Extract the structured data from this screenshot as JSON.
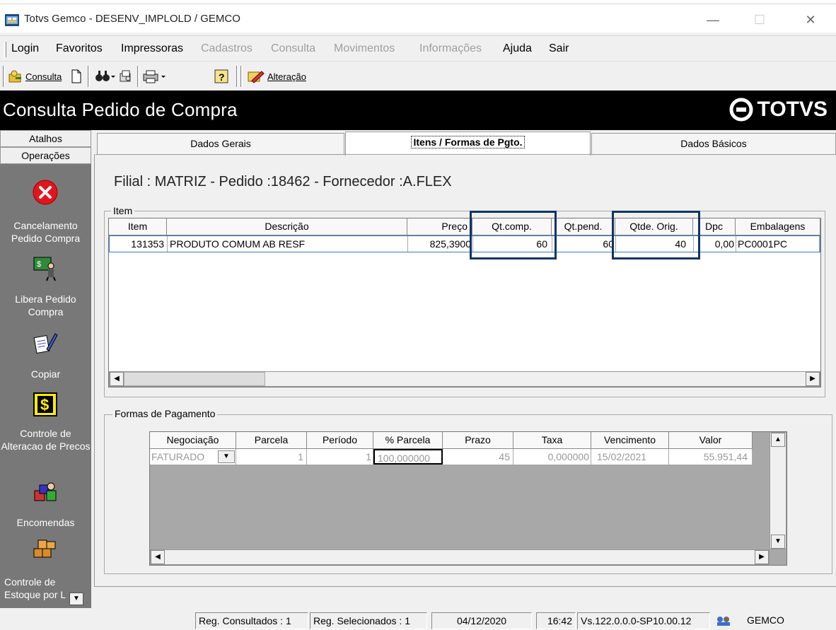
{
  "window": {
    "title": "Totvs Gemco - DESENV_IMPLOLD / GEMCO",
    "minimize": "—",
    "maximize": "☐",
    "close": "✕"
  },
  "menu": [
    {
      "label": "Login",
      "enabled": true
    },
    {
      "label": "Favoritos",
      "enabled": true
    },
    {
      "label": "Impressoras",
      "enabled": true
    },
    {
      "label": "Cadastros",
      "enabled": false
    },
    {
      "label": "Consulta",
      "enabled": false
    },
    {
      "label": "Movimentos",
      "enabled": false
    },
    {
      "label": "Informações",
      "enabled": false
    },
    {
      "label": "Ajuda",
      "enabled": true
    },
    {
      "label": "Sair",
      "enabled": true
    }
  ],
  "toolbar": {
    "consulta": "Consulta",
    "alteracao": "Alteração"
  },
  "header": {
    "title": "Consulta Pedido de Compra",
    "logo": "TOTVS"
  },
  "sidebar": {
    "tabs": [
      "Atalhos",
      "Operações"
    ],
    "items": [
      {
        "label": "Cancelamento Pedido Compra",
        "icon": "cancel-icon"
      },
      {
        "label": "Libera Pedido Compra",
        "icon": "release-icon"
      },
      {
        "label": "Copiar",
        "icon": "copy-icon"
      },
      {
        "label": "Controle de Alteracao de Precos",
        "icon": "price-control-icon"
      },
      {
        "label": "Encomendas",
        "icon": "orders-icon"
      },
      {
        "label": "Controle de Estoque por L",
        "icon": "stock-icon"
      }
    ]
  },
  "tabs": [
    "Dados Gerais",
    "Itens / Formas de Pgto.",
    "Dados Básicos"
  ],
  "filial": "Filial : MATRIZ - Pedido :18462 -  Fornecedor :A.FLEX",
  "items": {
    "legend": "Item",
    "headers": [
      "Item",
      "Descrição",
      "Preço",
      "Qt.comp.",
      "Qt.pend.",
      "Qtde. Orig.",
      "Dpc",
      "Embalagens"
    ],
    "rows": [
      [
        "131353",
        "PRODUTO COMUM  AB RESF",
        "825,3900",
        "60",
        "60",
        "40",
        "0,00",
        "PC0001PC"
      ]
    ]
  },
  "payments": {
    "legend": "Formas de Pagamento",
    "headers": [
      "Negociação",
      "Parcela",
      "Período",
      "% Parcela",
      "Prazo",
      "Taxa",
      "Vencimento",
      "Valor"
    ],
    "rows": [
      [
        "FATURADO",
        "1",
        "1",
        "100,000000",
        "45",
        "0,000000",
        "15/02/2021",
        "55.951,44"
      ]
    ]
  },
  "status": {
    "consultados": "Reg. Consultados : 1",
    "selecionados": "Reg. Selecionados : 1",
    "date": "04/12/2020",
    "time": "16:42",
    "version": "Vs.122.0.0.0-SP10.00.12",
    "user": "GEMCO"
  },
  "colors": {
    "highlight": "#0f3466",
    "sidebar": "#787878",
    "header": "#000000"
  }
}
